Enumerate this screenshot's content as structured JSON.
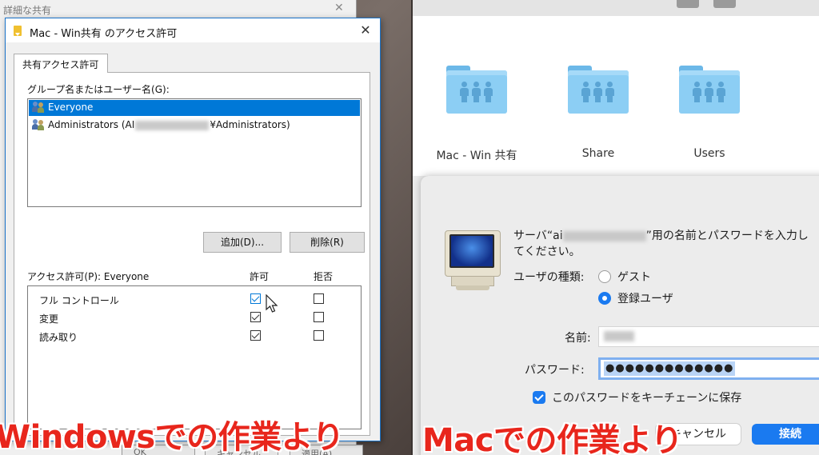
{
  "windows": {
    "background_window": {
      "title": "詳細な共有",
      "bottom_buttons": [
        "OK",
        "キャンセル",
        "適用(A)"
      ]
    },
    "dialog": {
      "title": "Mac - Win共有 のアクセス許可",
      "close_glyph": "✕",
      "tab_label": "共有アクセス許可",
      "group_label": "グループ名またはユーザー名(G):",
      "groups": [
        {
          "name": "Everyone",
          "selected": true
        },
        {
          "prefix": "Administrators (AI",
          "suffix": "¥Administrators)",
          "selected": false
        }
      ],
      "add_button": "追加(D)...",
      "remove_button": "削除(R)",
      "permissions_label": "アクセス許可(P): Everyone",
      "allow_header": "許可",
      "deny_header": "拒否",
      "permissions": [
        {
          "name": "フル コントロール",
          "allow": true,
          "deny": false
        },
        {
          "name": "変更",
          "allow": true,
          "deny": false
        },
        {
          "name": "読み取り",
          "allow": true,
          "deny": false
        }
      ]
    },
    "caption": "Windowsでの作業より"
  },
  "mac": {
    "folders": [
      {
        "label": "Mac - Win 共有"
      },
      {
        "label": "Share"
      },
      {
        "label": "Users"
      }
    ],
    "dialog": {
      "prompt_prefix": "サーバ“ai",
      "prompt_suffix": "”用の名前とパスワードを入力し",
      "prompt_line2": "てください。",
      "user_type_label": "ユーザの種類:",
      "guest_option": "ゲスト",
      "registered_option": "登録ユーザ",
      "selected_user_type": "registered",
      "name_label": "名前:",
      "password_label": "パスワード:",
      "password_value": "●●●●●●●●●●●●●",
      "keychain_label": "このパスワードをキーチェーンに保存",
      "keychain_checked": true,
      "cancel_button": "キャンセル",
      "connect_button": "接続"
    },
    "caption": "Macでの作業より",
    "accent_color": "#1a7af0"
  },
  "caption_color": "#e8261c"
}
